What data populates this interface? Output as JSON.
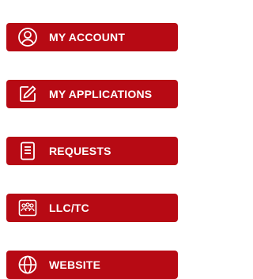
{
  "theme": {
    "button_color": "#b70a14",
    "text_color": "#ffffff"
  },
  "menu": {
    "items": [
      {
        "label": "MY ACCOUNT",
        "icon": "user-circle-icon"
      },
      {
        "label": "MY APPLICATIONS",
        "icon": "edit-square-icon"
      },
      {
        "label": "REQUESTS",
        "icon": "document-icon"
      },
      {
        "label": "LLC/TC",
        "icon": "group-icon"
      },
      {
        "label": "WEBSITE",
        "icon": "globe-icon"
      }
    ]
  }
}
